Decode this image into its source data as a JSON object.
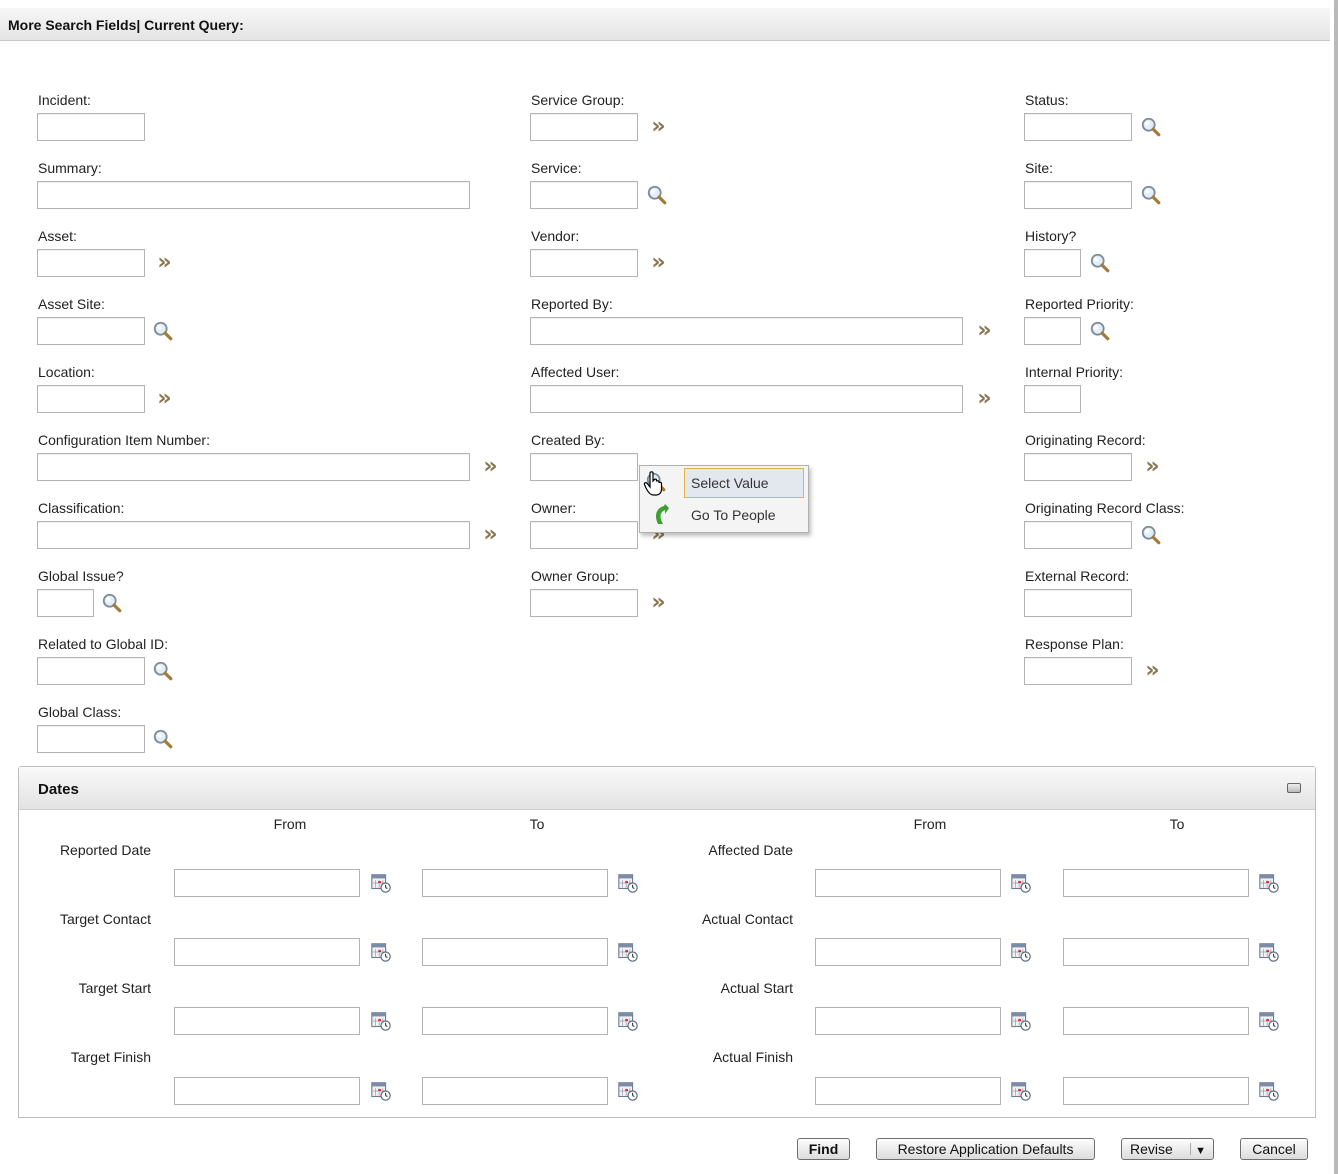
{
  "header": {
    "title": "More Search Fields| Current Query:"
  },
  "fields": {
    "incident": "Incident:",
    "summary": "Summary:",
    "asset": "Asset:",
    "asset_site": "Asset Site:",
    "location": "Location:",
    "ci_number": "Configuration Item Number:",
    "classification": "Classification:",
    "global_issue": "Global Issue?",
    "related_global_id": "Related to Global ID:",
    "global_class": "Global Class:",
    "service_group": "Service Group:",
    "service": "Service:",
    "vendor": "Vendor:",
    "reported_by": "Reported By:",
    "affected_user": "Affected User:",
    "created_by": "Created By:",
    "owner": "Owner:",
    "owner_group": "Owner Group:",
    "status": "Status:",
    "site": "Site:",
    "history": "History?",
    "reported_priority": "Reported Priority:",
    "internal_priority": "Internal Priority:",
    "originating_record": "Originating Record:",
    "originating_record_class": "Originating Record Class:",
    "external_record": "External Record:",
    "response_plan": "Response Plan:"
  },
  "context_menu": {
    "items": [
      "Select Value",
      "Go To People"
    ]
  },
  "dates": {
    "title": "Dates",
    "col_from": "From",
    "col_to": "To",
    "left_rows": [
      "Reported Date",
      "Target Contact",
      "Target Start",
      "Target Finish"
    ],
    "right_rows": [
      "Affected Date",
      "Actual Contact",
      "Actual Start",
      "Actual Finish"
    ]
  },
  "buttons": {
    "find": "Find",
    "restore": "Restore Application Defaults",
    "revise": "Revise",
    "cancel": "Cancel"
  },
  "icons": {
    "lookup": "magnifier-icon",
    "detail_menu": "double-chevron-icon",
    "calendar": "calendar-icon",
    "collapse": "collapse-section-icon"
  }
}
